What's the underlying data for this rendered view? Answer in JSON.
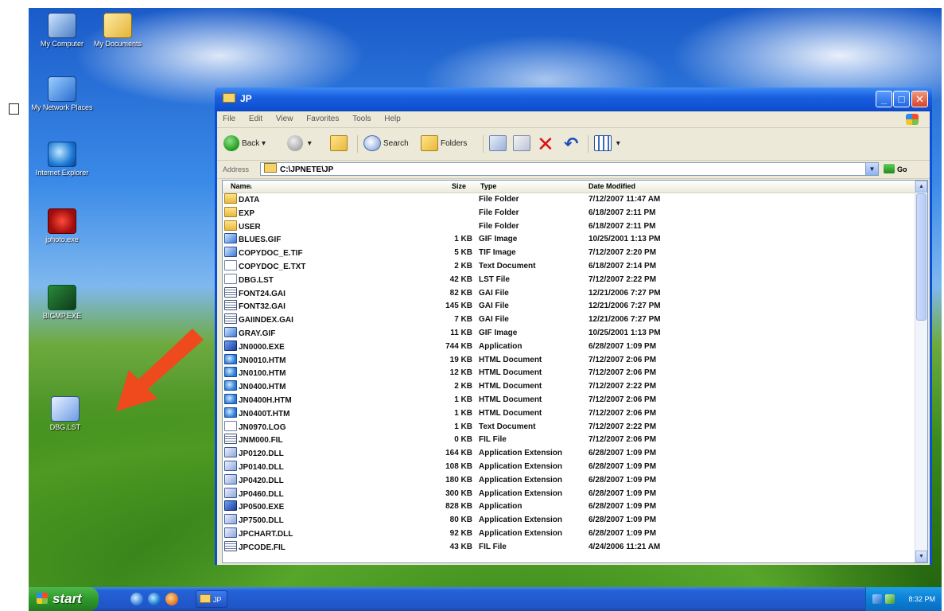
{
  "desktop": {
    "icons": [
      {
        "label": "My Computer"
      },
      {
        "label": "My Documents"
      },
      {
        "label": "My Network Places"
      },
      {
        "label": "Internet Explorer"
      },
      {
        "label": "jphoto.exe"
      },
      {
        "label": "BIGMP.EXE"
      },
      {
        "label": "DBG.LST"
      }
    ]
  },
  "window": {
    "title": "JP",
    "menu": [
      "File",
      "Edit",
      "View",
      "Favorites",
      "Tools",
      "Help"
    ],
    "toolbar": {
      "back": "Back",
      "search": "Search",
      "folders": "Folders"
    },
    "address": {
      "label": "Address",
      "value": "C:\\JPNETE\\JP",
      "go": "Go"
    },
    "columns": {
      "name": "Name",
      "size": "Size",
      "type": "Type",
      "date": "Date Modified"
    },
    "files": [
      {
        "name": "DATA",
        "size": "",
        "type": "File Folder",
        "date": "7/12/2007 11:47 AM",
        "icon": "folder"
      },
      {
        "name": "EXP",
        "size": "",
        "type": "File Folder",
        "date": "6/18/2007 2:11 PM",
        "icon": "folder"
      },
      {
        "name": "USER",
        "size": "",
        "type": "File Folder",
        "date": "6/18/2007 2:11 PM",
        "icon": "folder"
      },
      {
        "name": "BLUES.GIF",
        "size": "1 KB",
        "type": "GIF Image",
        "date": "10/25/2001 1:13 PM",
        "icon": "image"
      },
      {
        "name": "COPYDOC_E.TIF",
        "size": "5 KB",
        "type": "TIF Image",
        "date": "7/12/2007 2:20 PM",
        "icon": "image"
      },
      {
        "name": "COPYDOC_E.TXT",
        "size": "2 KB",
        "type": "Text Document",
        "date": "6/18/2007 2:14 PM",
        "icon": "text"
      },
      {
        "name": "DBG.LST",
        "size": "42 KB",
        "type": "LST File",
        "date": "7/12/2007 2:22 PM",
        "icon": "text"
      },
      {
        "name": "FONT24.GAI",
        "size": "82 KB",
        "type": "GAI File",
        "date": "12/21/2006 7:27 PM",
        "icon": "gai"
      },
      {
        "name": "FONT32.GAI",
        "size": "145 KB",
        "type": "GAI File",
        "date": "12/21/2006 7:27 PM",
        "icon": "gai"
      },
      {
        "name": "GAIINDEX.GAI",
        "size": "7 KB",
        "type": "GAI File",
        "date": "12/21/2006 7:27 PM",
        "icon": "gai"
      },
      {
        "name": "GRAY.GIF",
        "size": "11 KB",
        "type": "GIF Image",
        "date": "10/25/2001 1:13 PM",
        "icon": "image"
      },
      {
        "name": "JN0000.EXE",
        "size": "744 KB",
        "type": "Application",
        "date": "6/28/2007 1:09 PM",
        "icon": "exe"
      },
      {
        "name": "JN0010.HTM",
        "size": "19 KB",
        "type": "HTML Document",
        "date": "7/12/2007 2:06 PM",
        "icon": "htm"
      },
      {
        "name": "JN0100.HTM",
        "size": "12 KB",
        "type": "HTML Document",
        "date": "7/12/2007 2:06 PM",
        "icon": "htm"
      },
      {
        "name": "JN0400.HTM",
        "size": "2 KB",
        "type": "HTML Document",
        "date": "7/12/2007 2:22 PM",
        "icon": "htm"
      },
      {
        "name": "JN0400H.HTM",
        "size": "1 KB",
        "type": "HTML Document",
        "date": "7/12/2007 2:06 PM",
        "icon": "htm"
      },
      {
        "name": "JN0400T.HTM",
        "size": "1 KB",
        "type": "HTML Document",
        "date": "7/12/2007 2:06 PM",
        "icon": "htm"
      },
      {
        "name": "JN0970.LOG",
        "size": "1 KB",
        "type": "Text Document",
        "date": "7/12/2007 2:22 PM",
        "icon": "text"
      },
      {
        "name": "JNM000.FIL",
        "size": "0 KB",
        "type": "FIL File",
        "date": "7/12/2007 2:06 PM",
        "icon": "gai"
      },
      {
        "name": "JP0120.DLL",
        "size": "164 KB",
        "type": "Application Extension",
        "date": "6/28/2007 1:09 PM",
        "icon": "dll"
      },
      {
        "name": "JP0140.DLL",
        "size": "108 KB",
        "type": "Application Extension",
        "date": "6/28/2007 1:09 PM",
        "icon": "dll"
      },
      {
        "name": "JP0420.DLL",
        "size": "180 KB",
        "type": "Application Extension",
        "date": "6/28/2007 1:09 PM",
        "icon": "dll"
      },
      {
        "name": "JP0460.DLL",
        "size": "300 KB",
        "type": "Application Extension",
        "date": "6/28/2007 1:09 PM",
        "icon": "dll"
      },
      {
        "name": "JP0500.EXE",
        "size": "828 KB",
        "type": "Application",
        "date": "6/28/2007 1:09 PM",
        "icon": "exe"
      },
      {
        "name": "JP7500.DLL",
        "size": "80 KB",
        "type": "Application Extension",
        "date": "6/28/2007 1:09 PM",
        "icon": "dll"
      },
      {
        "name": "JPCHART.DLL",
        "size": "92 KB",
        "type": "Application Extension",
        "date": "6/28/2007 1:09 PM",
        "icon": "dll"
      },
      {
        "name": "JPCODE.FIL",
        "size": "43 KB",
        "type": "FIL File",
        "date": "4/24/2006 11:21 AM",
        "icon": "gai"
      }
    ]
  },
  "taskbar": {
    "start": "start",
    "task": "JP",
    "clock": "8:32 PM"
  },
  "colors": {
    "titlebar": "#0f4fd2",
    "annotation_arrow": "#ee4a1e"
  }
}
